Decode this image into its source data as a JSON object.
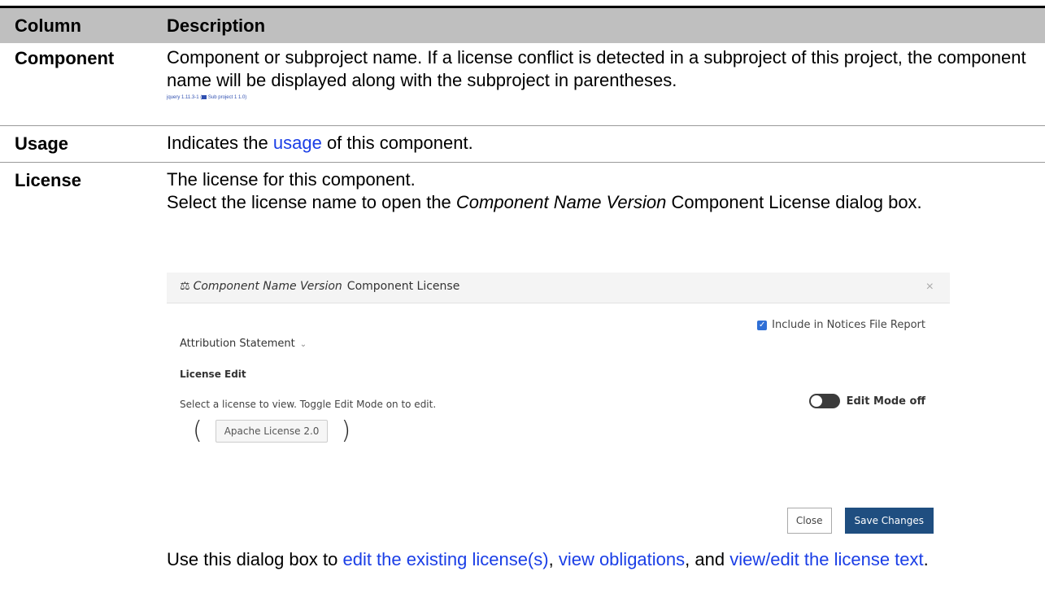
{
  "header": {
    "col": "Column",
    "desc": "Description"
  },
  "rows": [
    {
      "name": "Component",
      "text": "Component or subproject name. If a license conflict is detected in a subproject of this project, the component name will be displayed along with the subproject in parentheses.",
      "example_component": "jquery 1.11.3-1 (",
      "example_subproject": "Sub project 1 1.0)"
    },
    {
      "name": "Usage",
      "pre": "Indicates the ",
      "link": "usage",
      "post": " of this component."
    },
    {
      "name": "License",
      "line1": "The license for this component.",
      "line2_pre": "Select the license name to open the ",
      "line2_italic": "Component Name Version",
      "line2_post": " Component License dialog box."
    }
  ],
  "dialog": {
    "title_italic": "Component Name Version",
    "title_rest": "Component License",
    "close_glyph": "×",
    "include_label": "Include in Notices File Report",
    "attribution": "Attribution Statement",
    "license_edit": "License Edit",
    "select_text": "Select a license to view. Toggle Edit Mode on to edit.",
    "edit_mode": "Edit Mode off",
    "license_name": "Apache License 2.0",
    "paren_open": "(",
    "paren_close": ")",
    "btn_close": "Close",
    "btn_save": "Save Changes"
  },
  "after": {
    "pre": "Use this dialog box to ",
    "link1": "edit the existing license(s)",
    "mid1": ", ",
    "link2": "view obligations",
    "mid2": ", and ",
    "link3": "view/edit the license text",
    "post": "."
  }
}
